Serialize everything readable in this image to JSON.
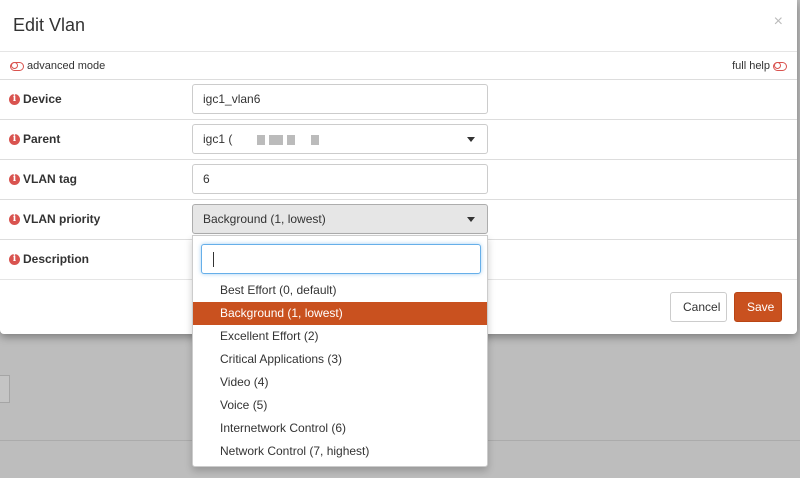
{
  "modal": {
    "title": "Edit Vlan",
    "close": "×"
  },
  "mode": {
    "advanced_label": "advanced mode",
    "full_help_label": "full help"
  },
  "fields": {
    "device": {
      "label": "Device",
      "value": "igc1_vlan6"
    },
    "parent": {
      "label": "Parent",
      "value": "igc1 ("
    },
    "vlan_tag": {
      "label": "VLAN tag",
      "value": "6"
    },
    "vlan_priority": {
      "label": "VLAN priority",
      "value": "Background (1, lowest)"
    },
    "description": {
      "label": "Description",
      "value": ""
    }
  },
  "dropdown": {
    "search_value": "",
    "options": [
      {
        "label": "Best Effort (0, default)",
        "selected": false
      },
      {
        "label": "Background (1, lowest)",
        "selected": true
      },
      {
        "label": "Excellent Effort (2)",
        "selected": false
      },
      {
        "label": "Critical Applications (3)",
        "selected": false
      },
      {
        "label": "Video (4)",
        "selected": false
      },
      {
        "label": "Voice (5)",
        "selected": false
      },
      {
        "label": "Internetwork Control (6)",
        "selected": false
      },
      {
        "label": "Network Control (7, highest)",
        "selected": false
      }
    ]
  },
  "footer": {
    "cancel_label": "Cancel",
    "save_label": "Save"
  },
  "colors": {
    "accent": "#c9511f",
    "info": "#d9534f"
  }
}
